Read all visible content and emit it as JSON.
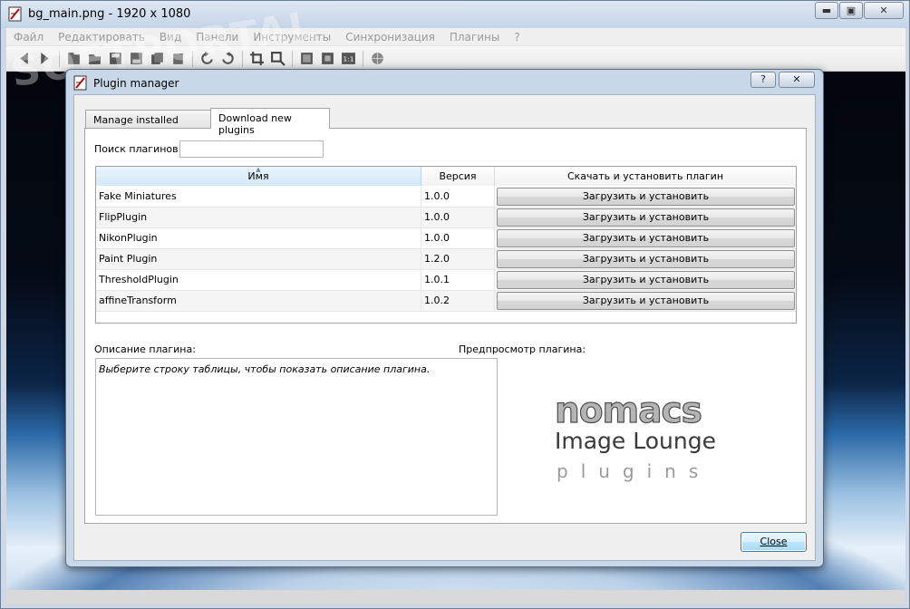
{
  "main_window": {
    "title": "bg_main.png  - 1920 x 1080",
    "controls": {
      "minimize": "▬",
      "maximize": "▣",
      "close": "✕"
    },
    "menu": [
      "Файл",
      "Редактировать",
      "Вид",
      "Панели",
      "Инструменты",
      "Синхронизация",
      "Плагины",
      "?"
    ]
  },
  "toolbar_icons": [
    "back-icon",
    "forward-icon",
    "open-icon",
    "open-dir-icon",
    "save-icon",
    "save-as-icon",
    "copy-icon",
    "paste-icon",
    "rotate-left-icon",
    "rotate-right-icon",
    "crop-icon",
    "resize-icon",
    "fullscreen-icon",
    "fit-icon",
    "zoom-100-icon",
    "web-icon"
  ],
  "dialog": {
    "title": "Plugin manager",
    "help_label": "?",
    "close_label": "✕",
    "tabs": [
      {
        "label": "Manage installed plugins",
        "active": false
      },
      {
        "label": "Download new plugins",
        "active": true
      }
    ],
    "search": {
      "label": "Поиск плагинов:",
      "value": "",
      "placeholder": ""
    },
    "table": {
      "headers": {
        "name": "Имя",
        "version": "Версия",
        "action": "Скачать и установить плагин"
      },
      "rows": [
        {
          "name": "Fake Miniatures",
          "version": "1.0.0",
          "button": "Загрузить и установить"
        },
        {
          "name": "FlipPlugin",
          "version": "1.0.0",
          "button": "Загрузить и установить"
        },
        {
          "name": "NikonPlugin",
          "version": "1.0.0",
          "button": "Загрузить и установить"
        },
        {
          "name": "Paint Plugin",
          "version": "1.2.0",
          "button": "Загрузить и установить"
        },
        {
          "name": "ThresholdPlugin",
          "version": "1.0.1",
          "button": "Загрузить и установить"
        },
        {
          "name": "affineTransform",
          "version": "1.0.2",
          "button": "Загрузить и установить"
        }
      ]
    },
    "description": {
      "label": "Описание плагина:",
      "text": "Выберите строку таблицы, чтобы показать описание плагина."
    },
    "preview": {
      "label": "Предпросмотр плагина:",
      "logo_main": "nomacs",
      "logo_sub": "Image Lounge",
      "logo_tag": "plugins"
    },
    "close_button": "Close"
  },
  "watermark": "SOFTPORTAL",
  "colors": {
    "accent": "#3c7fb1",
    "header_selected": "#d5e9f8"
  }
}
